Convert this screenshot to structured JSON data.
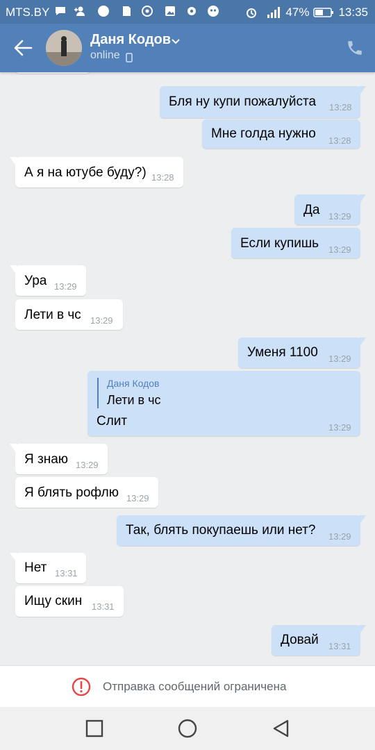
{
  "status": {
    "carrier": "MTS.BY",
    "battery": "47%",
    "time": "13:35"
  },
  "header": {
    "name": "Даня Кодов",
    "status": "online"
  },
  "messages": [
    {
      "side": "out",
      "text": "Бля ну купи пожалуйста",
      "time": "13:28"
    },
    {
      "side": "out",
      "text": "Мне голда нужно",
      "time": "13:28"
    },
    {
      "side": "in",
      "text": "А я на ютубе буду?)",
      "time": "13:28"
    },
    {
      "side": "out",
      "text": "Да",
      "time": "13:29"
    },
    {
      "side": "out",
      "text": "Если купишь",
      "time": "13:29"
    },
    {
      "side": "in",
      "text": "Ура",
      "time": "13:29"
    },
    {
      "side": "in",
      "text": "Лети в чс",
      "time": "13:29"
    },
    {
      "side": "out",
      "text": "Уменя 1100",
      "time": "13:29"
    },
    {
      "side": "out",
      "text": "Слит",
      "time": "13:29",
      "reply_author": "Даня Кодов",
      "reply_text": "Лети в чс"
    },
    {
      "side": "in",
      "text": "Я знаю",
      "time": "13:29"
    },
    {
      "side": "in",
      "text": "Я блять рофлю",
      "time": "13:29"
    },
    {
      "side": "out",
      "text": "Так, блять покупаешь или нет?",
      "time": "13:29"
    },
    {
      "side": "in",
      "text": "Нет",
      "time": "13:31"
    },
    {
      "side": "in",
      "text": "Ищу скин",
      "time": "13:31"
    },
    {
      "side": "out",
      "text": "Довай",
      "time": "13:31"
    }
  ],
  "footer": {
    "notice": "Отправка сообщений ограничена"
  },
  "colors": {
    "header": "#5181b8",
    "outgoing_bubble": "#cce0f7",
    "incoming_bubble": "#ffffff",
    "warning": "#e64646"
  }
}
